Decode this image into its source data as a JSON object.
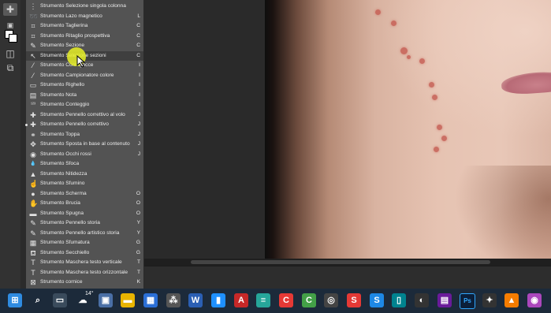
{
  "menu": {
    "items": [
      {
        "label": "Strumento Selezione singola colonna",
        "key": "",
        "icon": "column-select-icon",
        "glyph": "⋮"
      },
      {
        "label": "Strumento Lazo magnetico",
        "key": "L",
        "icon": "magnetic-lasso-icon",
        "glyph": "➿"
      },
      {
        "label": "Strumento Taglierina",
        "key": "C",
        "icon": "crop-icon",
        "glyph": "⌗"
      },
      {
        "label": "Strumento Ritaglio prospettiva",
        "key": "C",
        "icon": "perspective-crop-icon",
        "glyph": "⌗"
      },
      {
        "label": "Strumento Sezione",
        "key": "C",
        "icon": "slice-icon",
        "glyph": "✎"
      },
      {
        "label": "Strumento Selezione sezioni",
        "key": "C",
        "icon": "slice-select-icon",
        "glyph": "↖"
      },
      {
        "label": "Strumento Contagocce",
        "key": "I",
        "icon": "eyedropper-icon",
        "glyph": "⁄"
      },
      {
        "label": "Strumento Campionatore colore",
        "key": "I",
        "icon": "color-sampler-icon",
        "glyph": "⁄"
      },
      {
        "label": "Strumento Righello",
        "key": "I",
        "icon": "ruler-icon",
        "glyph": "▭"
      },
      {
        "label": "Strumento Nota",
        "key": "I",
        "icon": "note-icon",
        "glyph": "▤"
      },
      {
        "label": "Strumento Conteggio",
        "key": "I",
        "icon": "count-icon",
        "glyph": "¹²³"
      },
      {
        "label": "Strumento Pennello correttivo al volo",
        "key": "J",
        "icon": "spot-healing-icon",
        "glyph": "✚"
      },
      {
        "label": "Strumento Pennello correttivo",
        "key": "J",
        "icon": "healing-brush-icon",
        "glyph": "✚"
      },
      {
        "label": "Strumento Toppa",
        "key": "J",
        "icon": "patch-icon",
        "glyph": "⚭"
      },
      {
        "label": "Strumento Sposta in base al contenuto",
        "key": "J",
        "icon": "content-aware-move-icon",
        "glyph": "✥"
      },
      {
        "label": "Strumento Occhi rossi",
        "key": "J",
        "icon": "red-eye-icon",
        "glyph": "◉"
      },
      {
        "label": "Strumento Sfoca",
        "key": "",
        "icon": "blur-icon",
        "glyph": "💧"
      },
      {
        "label": "Strumento Nitidezza",
        "key": "",
        "icon": "sharpen-icon",
        "glyph": "▲"
      },
      {
        "label": "Strumento Sfumino",
        "key": "",
        "icon": "smudge-icon",
        "glyph": "☝"
      },
      {
        "label": "Strumento Scherma",
        "key": "O",
        "icon": "dodge-icon",
        "glyph": "●"
      },
      {
        "label": "Strumento Brucia",
        "key": "O",
        "icon": "burn-icon",
        "glyph": "✋"
      },
      {
        "label": "Strumento Spugna",
        "key": "O",
        "icon": "sponge-icon",
        "glyph": "▬"
      },
      {
        "label": "Strumento Pennello storia",
        "key": "Y",
        "icon": "history-brush-icon",
        "glyph": "✎"
      },
      {
        "label": "Strumento Pennello artistico storia",
        "key": "Y",
        "icon": "art-history-brush-icon",
        "glyph": "✎"
      },
      {
        "label": "Strumento Sfumatura",
        "key": "G",
        "icon": "gradient-icon",
        "glyph": "▦"
      },
      {
        "label": "Strumento Secchiello",
        "key": "G",
        "icon": "paint-bucket-icon",
        "glyph": "⛾"
      },
      {
        "label": "Strumento Maschera testo verticale",
        "key": "T",
        "icon": "vertical-type-mask-icon",
        "glyph": "T"
      },
      {
        "label": "Strumento Maschera testo orizzontale",
        "key": "T",
        "icon": "horizontal-type-mask-icon",
        "glyph": "T"
      },
      {
        "label": "Strumento cornice",
        "key": "K",
        "icon": "frame-icon",
        "glyph": "⊠"
      }
    ]
  },
  "taskbar": {
    "weather_temp": "14°",
    "icons": [
      "windows-start-icon",
      "search-icon",
      "task-view-icon",
      "weather-icon",
      "chat-icon",
      "file-explorer-icon",
      "store-icon",
      "wifi-app-icon",
      "word-icon",
      "app-icon",
      "acrobat-icon",
      "notes-icon",
      "capcut-icon",
      "camtasia-icon",
      "obs-icon",
      "app-s-icon",
      "app-s2-icon",
      "app-icon-2",
      "davinci-icon",
      "app-icon-3",
      "photoshop-icon",
      "game-icon",
      "vlc-icon",
      "opera-icon"
    ]
  },
  "colors": {
    "menu_bg": "#535353",
    "highlight": "#3f3f3f",
    "cursor_highlight": "#e8f028",
    "taskbar_bg": "#1c2a3a"
  }
}
